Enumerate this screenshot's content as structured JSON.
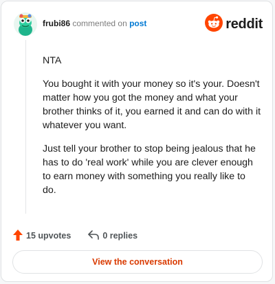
{
  "comment": {
    "username": "frubi86",
    "action_text": "commented on",
    "target_link": "post",
    "paragraphs": [
      "NTA",
      "You bought it with your money so it's your. Doesn't matter how you got the money and what your brother thinks of it, you earned it and can do with it whatever you want.",
      "Just tell your brother to stop being jealous that he has to do 'real work' while you are clever enough to earn money with something you really like to do."
    ]
  },
  "brand": {
    "name": "reddit",
    "accent": "#ff4500"
  },
  "actions": {
    "upvotes": "15 upvotes",
    "replies": "0 replies"
  },
  "cta": {
    "label": "View the conversation",
    "color": "#d93a00"
  },
  "colors": {
    "link": "#0079d3",
    "text": "#1c1c1c",
    "muted": "#7c7c7c"
  },
  "icons": [
    "avatar",
    "reddit-logo-icon",
    "upvote-arrow-icon",
    "reply-icon"
  ]
}
